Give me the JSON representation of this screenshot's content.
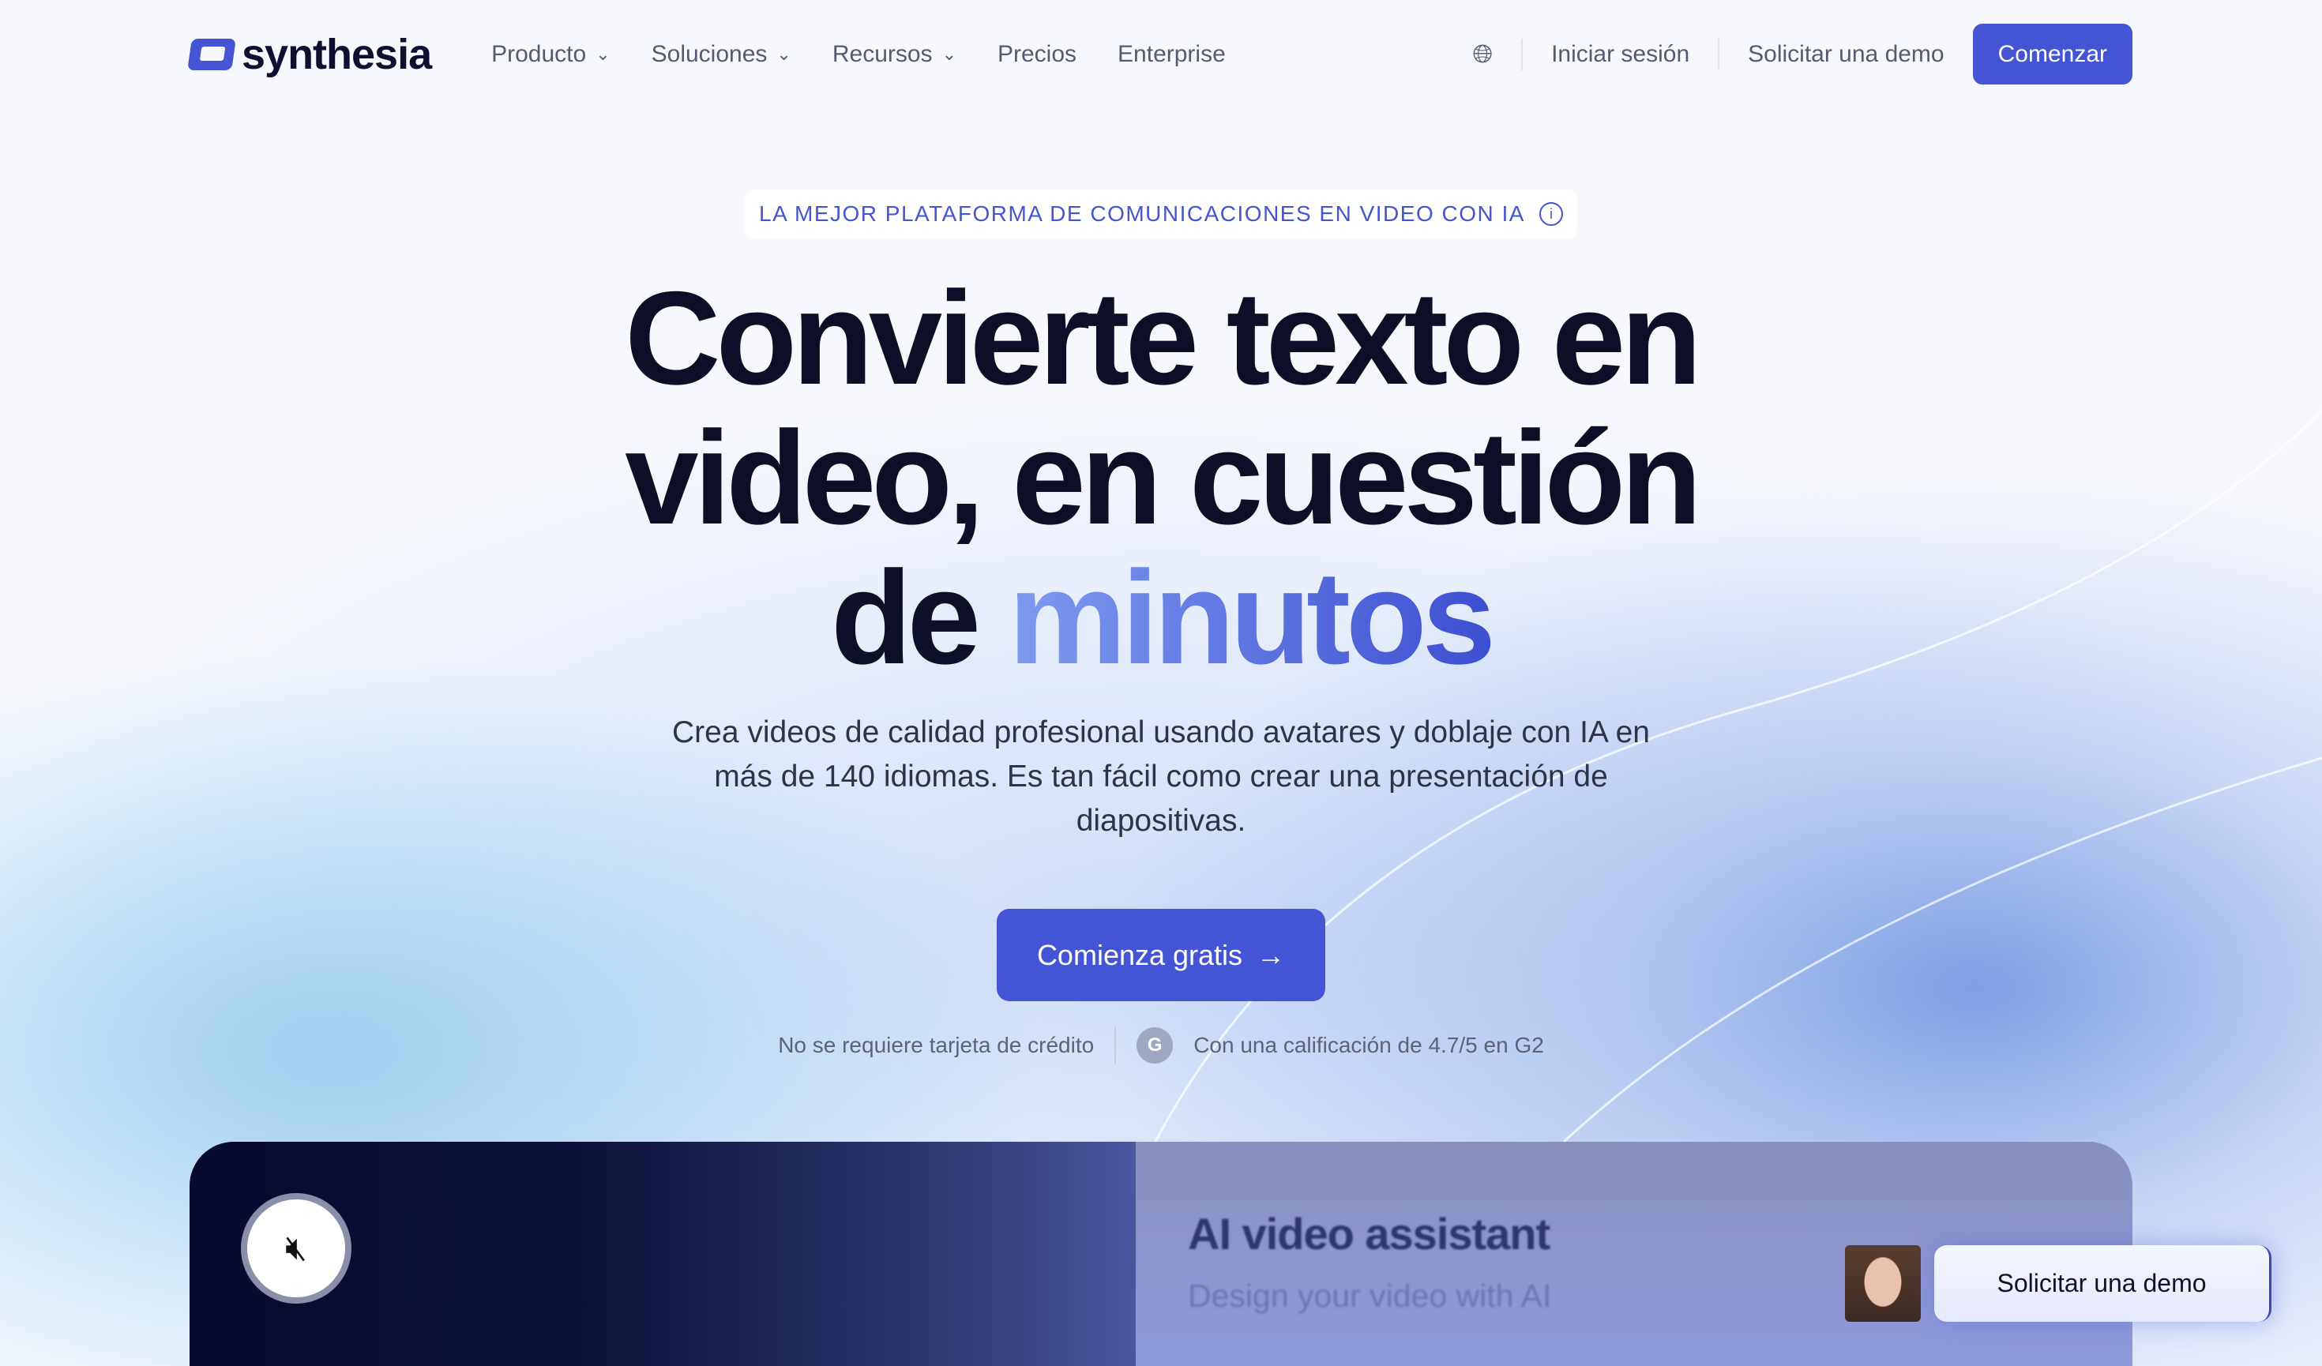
{
  "nav": {
    "logo": "synthesia",
    "items": [
      {
        "label": "Producto",
        "dropdown": true
      },
      {
        "label": "Soluciones",
        "dropdown": true
      },
      {
        "label": "Recursos",
        "dropdown": true
      },
      {
        "label": "Precios"
      },
      {
        "label": "Enterprise"
      }
    ],
    "login": "Iniciar sesión",
    "demo": "Solicitar una demo",
    "start": "Comenzar"
  },
  "hero": {
    "badge": "LA MEJOR PLATAFORMA DE COMUNICACIONES EN VIDEO CON IA",
    "title_line1": "Convierte texto en",
    "title_line2": "video, en cuestión",
    "title_line3_a": "de ",
    "title_highlight": "minutos",
    "subtitle": "Crea videos de calidad profesional usando avatares y doblaje con IA en más de 140 idiomas. Es tan fácil como crear una presentación de diapositivas.",
    "cta": "Comienza gratis",
    "arrow": "→",
    "no_card": "No se requiere tarjeta de crédito",
    "g2_logo": "G2",
    "rating": "Con una calificación de 4.7/5 en G2"
  },
  "video": {
    "title": "AI video assistant",
    "subtitle": "Design your video with AI"
  },
  "floating": {
    "demo": "Solicitar una demo"
  },
  "colors": {
    "accent": "#4355d4",
    "text": "#0d0f26"
  }
}
